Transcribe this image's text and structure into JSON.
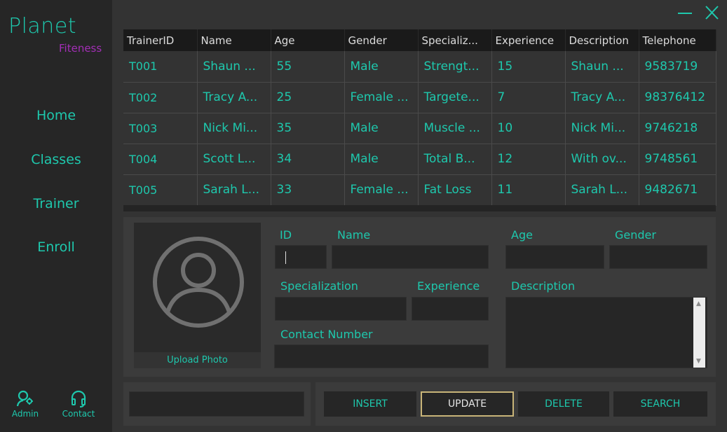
{
  "window": {
    "minimize_label": "Minimize",
    "close_label": "Close"
  },
  "sidebar": {
    "brand_main": "Planet",
    "brand_sub": "Fiteness",
    "nav": [
      {
        "label": "Home"
      },
      {
        "label": "Classes"
      },
      {
        "label": "Trainer"
      },
      {
        "label": "Enroll"
      }
    ],
    "footer": [
      {
        "label": "Admin",
        "icon": "admin-settings-icon"
      },
      {
        "label": "Contact",
        "icon": "headset-icon"
      }
    ]
  },
  "table": {
    "headers": [
      "TrainerID",
      "Name",
      "Age",
      "Gender",
      "Specializ...",
      "Experience",
      "Description",
      "Telephone"
    ],
    "rows": [
      [
        "T001",
        "Shaun ...",
        "55",
        "Male",
        "Strengt...",
        "15",
        "Shaun ...",
        "9583719"
      ],
      [
        "T002",
        "Tracy A...",
        "25",
        "Female ...",
        "Targete...",
        "7",
        "Tracy A...",
        "98376412"
      ],
      [
        "T003",
        "Nick Mi...",
        "35",
        "Male",
        "Muscle ...",
        "10",
        "Nick Mi...",
        "9746218"
      ],
      [
        "T004",
        "Scott L...",
        "34",
        "Male",
        "Total B...",
        "12",
        "With ov...",
        "9748561"
      ],
      [
        "T005",
        "Sarah L...",
        "33",
        "Female ...",
        "Fat Loss",
        "11",
        "Sarah L...",
        "9482671"
      ]
    ]
  },
  "form": {
    "upload_label": "Upload Photo",
    "id_label": "ID",
    "name_label": "Name",
    "age_label": "Age",
    "gender_label": "Gender",
    "specialization_label": "Specialization",
    "experience_label": "Experience",
    "description_label": "Description",
    "contact_label": "Contact Number",
    "id_value": "",
    "name_value": "",
    "age_value": "",
    "gender_value": "",
    "specialization_value": "",
    "experience_value": "",
    "description_value": "",
    "contact_value": ""
  },
  "search": {
    "value": ""
  },
  "actions": {
    "insert": "INSERT",
    "update": "UPDATE",
    "delete": "DELETE",
    "search": "SEARCH"
  },
  "colors": {
    "accent": "#1ec8ad",
    "brand_sub": "#a32eb6",
    "active_border": "#c8b478",
    "background": "#333333",
    "sidebar": "#262626"
  }
}
